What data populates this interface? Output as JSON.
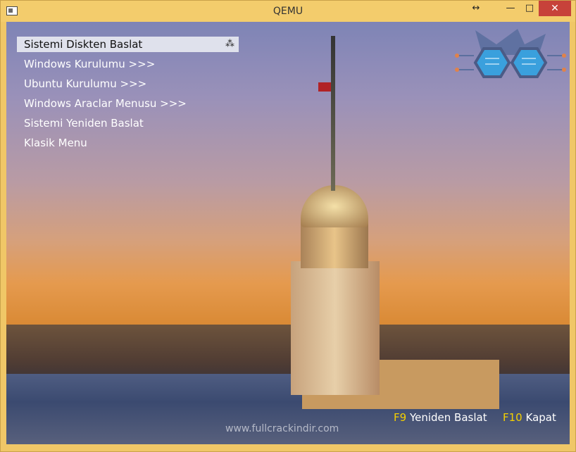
{
  "window": {
    "title": "QEMU",
    "controls": {
      "resize": "↔",
      "minimize": "—",
      "maximize": "□",
      "close": "✕"
    }
  },
  "menu": {
    "items": [
      {
        "label": "Sistemi Diskten Baslat",
        "selected": true
      },
      {
        "label": "Windows Kurulumu >>>"
      },
      {
        "label": "Ubuntu Kurulumu >>>"
      },
      {
        "label": "Windows Araclar Menusu >>>"
      },
      {
        "label": "Sistemi Yeniden Baslat"
      },
      {
        "label": "Klasik Menu"
      }
    ],
    "spinner": "⁂"
  },
  "hints": {
    "restart": {
      "key": "F9",
      "label": "Yeniden Baslat"
    },
    "shutdown": {
      "key": "F10",
      "label": "Kapat"
    }
  },
  "watermark": "www.fullcrackindir.com",
  "colors": {
    "titlebar": "#f3cc6c",
    "close": "#c7423a",
    "hint_key": "#f5d000",
    "selected_item": "#dfe1ec"
  },
  "icons": {
    "app": "qemu-window-icon",
    "logo": "geek-glasses-logo-icon",
    "spinner": "loading-spinner-icon"
  }
}
